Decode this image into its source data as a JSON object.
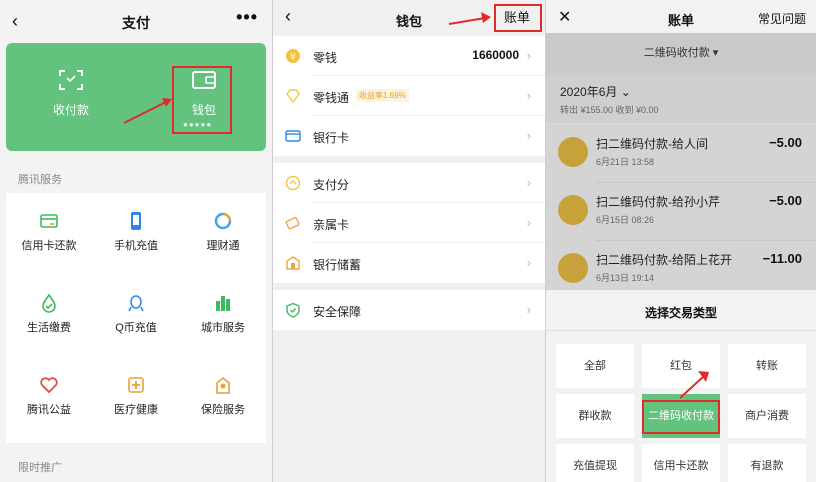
{
  "pay_screen": {
    "title": "支付",
    "more": "•••",
    "card": {
      "collect_label": "收付款",
      "wallet_label": "钱包",
      "wallet_dots": "●●●●●"
    },
    "services_title": "腾讯服务",
    "services": [
      {
        "label": "信用卡还款",
        "icon": "credit-card-icon"
      },
      {
        "label": "手机充值",
        "icon": "phone-icon"
      },
      {
        "label": "理财通",
        "icon": "wealth-icon"
      },
      {
        "label": "生活缴费",
        "icon": "life-payment-icon"
      },
      {
        "label": "Q币充值",
        "icon": "qq-coin-icon"
      },
      {
        "label": "城市服务",
        "icon": "city-icon"
      },
      {
        "label": "腾讯公益",
        "icon": "charity-icon"
      },
      {
        "label": "医疗健康",
        "icon": "medical-icon"
      },
      {
        "label": "保险服务",
        "icon": "insurance-icon"
      }
    ],
    "promo_title": "限时推广"
  },
  "wallet_screen": {
    "title": "钱包",
    "bill_link": "账单",
    "items": [
      {
        "label": "零钱",
        "value": "1660000",
        "icon": "yuan-coin-icon"
      },
      {
        "label": "零钱通",
        "badge": "收益率1.69%",
        "icon": "diamond-icon"
      },
      {
        "label": "银行卡",
        "icon": "bank-card-icon"
      },
      {
        "label": "支付分",
        "icon": "score-icon"
      },
      {
        "label": "亲属卡",
        "icon": "family-card-icon"
      },
      {
        "label": "银行储蓄",
        "icon": "savings-icon"
      },
      {
        "label": "安全保障",
        "icon": "shield-icon"
      }
    ]
  },
  "bill_screen": {
    "title": "账单",
    "faq": "常见问题",
    "filter": "二维码收付款 ▾",
    "month": "2020年6月 ⌄",
    "summary": "转出 ¥155.00 收到 ¥0.00",
    "transactions": [
      {
        "title": "扫二维码付款-给人间",
        "date": "6月21日 13:58",
        "amount": "−5.00"
      },
      {
        "title": "扫二维码付款-给孙小芹",
        "date": "6月15日 08:26",
        "amount": "−5.00"
      },
      {
        "title": "扫二维码付款-给陌上花开",
        "date": "6月13日 19:14",
        "amount": "−11.00"
      }
    ],
    "sheet_title": "选择交易类型",
    "types": [
      "全部",
      "红包",
      "转账",
      "群收款",
      "二维码收付款",
      "商户消费",
      "充值提现",
      "信用卡还款",
      "有退款"
    ],
    "selected_type": "二维码收付款"
  },
  "colors": {
    "brand_green": "#63c37e",
    "highlight_red": "#e02b2b",
    "coin_gold": "#c7a23b"
  }
}
